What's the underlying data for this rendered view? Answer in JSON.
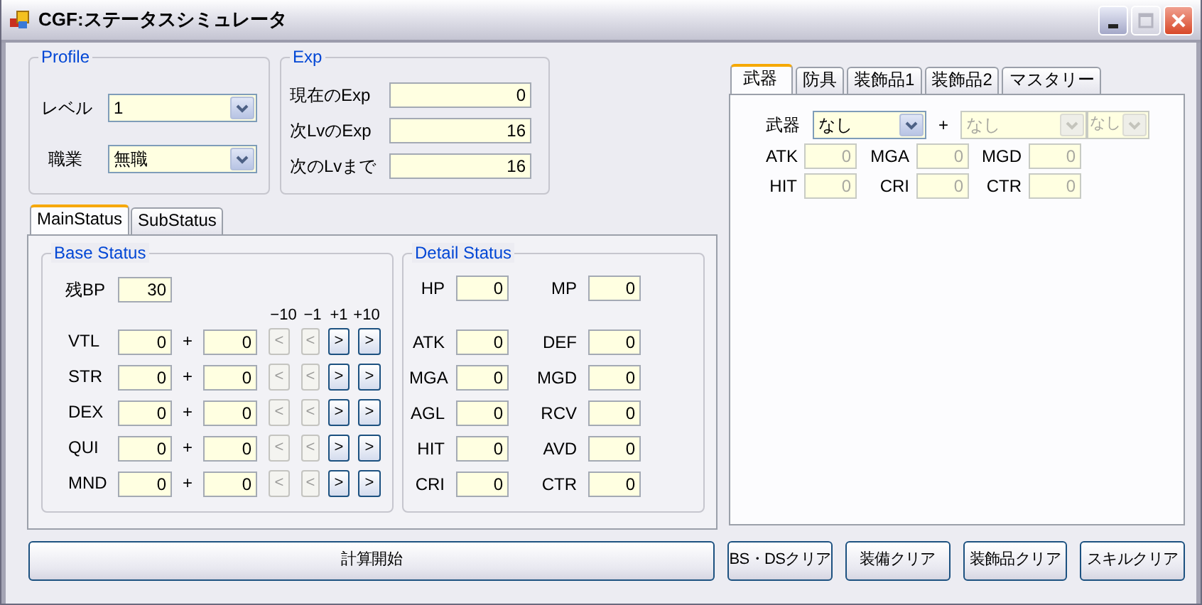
{
  "window": {
    "title": "CGF:ステータスシミュレータ"
  },
  "profile": {
    "title": "Profile",
    "fields": [
      {
        "label": "レベル",
        "value": "1"
      },
      {
        "label": "職業",
        "value": "無職"
      }
    ]
  },
  "exp": {
    "title": "Exp",
    "fields": [
      {
        "label": "現在のExp",
        "value": "0"
      },
      {
        "label": "次LvのExp",
        "value": "16"
      },
      {
        "label": "次のLvまで",
        "value": "16"
      }
    ]
  },
  "main_tabs": [
    {
      "label": "MainStatus",
      "selected": true
    },
    {
      "label": "SubStatus",
      "selected": false
    }
  ],
  "base_status": {
    "title": "Base Status",
    "remaining_bp": {
      "label": "残BP",
      "value": "30"
    },
    "step_headers": [
      "−10",
      "−1",
      "+1",
      "+10"
    ],
    "rows": [
      {
        "label": "VTL",
        "base": "0",
        "sign": "+",
        "bonus": "0",
        "buttons": [
          {
            "glyph": "<",
            "disabled": true
          },
          {
            "glyph": "<",
            "disabled": true
          },
          {
            "glyph": ">",
            "disabled": false
          },
          {
            "glyph": ">",
            "disabled": false
          }
        ]
      },
      {
        "label": "STR",
        "base": "0",
        "sign": "+",
        "bonus": "0",
        "buttons": [
          {
            "glyph": "<",
            "disabled": true
          },
          {
            "glyph": "<",
            "disabled": true
          },
          {
            "glyph": ">",
            "disabled": false
          },
          {
            "glyph": ">",
            "disabled": false
          }
        ]
      },
      {
        "label": "DEX",
        "base": "0",
        "sign": "+",
        "bonus": "0",
        "buttons": [
          {
            "glyph": "<",
            "disabled": true
          },
          {
            "glyph": "<",
            "disabled": true
          },
          {
            "glyph": ">",
            "disabled": false
          },
          {
            "glyph": ">",
            "disabled": false
          }
        ]
      },
      {
        "label": "QUI",
        "base": "0",
        "sign": "+",
        "bonus": "0",
        "buttons": [
          {
            "glyph": "<",
            "disabled": true
          },
          {
            "glyph": "<",
            "disabled": true
          },
          {
            "glyph": ">",
            "disabled": false
          },
          {
            "glyph": ">",
            "disabled": false
          }
        ]
      },
      {
        "label": "MND",
        "base": "0",
        "sign": "+",
        "bonus": "0",
        "buttons": [
          {
            "glyph": "<",
            "disabled": true
          },
          {
            "glyph": "<",
            "disabled": true
          },
          {
            "glyph": ">",
            "disabled": false
          },
          {
            "glyph": ">",
            "disabled": false
          }
        ]
      }
    ]
  },
  "detail_status": {
    "title": "Detail Status",
    "vitals": [
      {
        "label": "HP",
        "value": "0"
      },
      {
        "label": "MP",
        "value": "0"
      }
    ],
    "stats": [
      [
        {
          "label": "ATK",
          "value": "0"
        },
        {
          "label": "DEF",
          "value": "0"
        }
      ],
      [
        {
          "label": "MGA",
          "value": "0"
        },
        {
          "label": "MGD",
          "value": "0"
        }
      ],
      [
        {
          "label": "AGL",
          "value": "0"
        },
        {
          "label": "RCV",
          "value": "0"
        }
      ],
      [
        {
          "label": "HIT",
          "value": "0"
        },
        {
          "label": "AVD",
          "value": "0"
        }
      ],
      [
        {
          "label": "CRI",
          "value": "0"
        },
        {
          "label": "CTR",
          "value": "0"
        }
      ]
    ]
  },
  "equip_tabs": [
    {
      "label": "武器",
      "selected": true
    },
    {
      "label": "防具",
      "selected": false
    },
    {
      "label": "装飾品1",
      "selected": false
    },
    {
      "label": "装飾品2",
      "selected": false
    },
    {
      "label": "マスタリー",
      "selected": false
    }
  ],
  "weapon": {
    "label": "武器",
    "select": {
      "value": "なし",
      "disabled": false
    },
    "sign": "+",
    "refine": {
      "value": "なし",
      "disabled": true
    },
    "grade": {
      "value": "なし",
      "disabled": true
    },
    "stats": [
      [
        {
          "label": "ATK",
          "value": "0",
          "disabled": true
        },
        {
          "label": "MGA",
          "value": "0",
          "disabled": true
        },
        {
          "label": "MGD",
          "value": "0",
          "disabled": true
        }
      ],
      [
        {
          "label": "HIT",
          "value": "0",
          "disabled": true
        },
        {
          "label": "CRI",
          "value": "0",
          "disabled": true
        },
        {
          "label": "CTR",
          "value": "0",
          "disabled": true
        }
      ]
    ]
  },
  "buttons": [
    {
      "label": "計算開始",
      "kind": "wide"
    },
    {
      "label": "BS・DSクリア",
      "kind": "normal"
    },
    {
      "label": "装備クリア",
      "kind": "normal"
    },
    {
      "label": "装飾品クリア",
      "kind": "normal"
    },
    {
      "label": "スキルクリア",
      "kind": "normal"
    }
  ]
}
